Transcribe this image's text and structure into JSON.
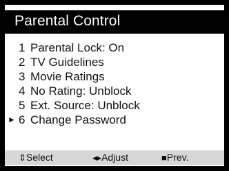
{
  "colors": {
    "title_bg": "#000000",
    "title_text": "#ffffff",
    "body_bg": "#ffffff",
    "footer_bg": "#d7d7d7",
    "text": "#111111"
  },
  "title": "Parental Control",
  "menu": {
    "items": [
      {
        "number": "1",
        "label": "Parental Lock:  On",
        "selected": false
      },
      {
        "number": "2",
        "label": "TV Guidelines",
        "selected": false
      },
      {
        "number": "3",
        "label": "Movie Ratings",
        "selected": false
      },
      {
        "number": "4",
        "label": "No Rating:  Unblock",
        "selected": false
      },
      {
        "number": "5",
        "label": "Ext. Source:  Unblock",
        "selected": false
      },
      {
        "number": "6",
        "label": "Change Password",
        "selected": true
      }
    ],
    "selection_marker": "►"
  },
  "footer": {
    "select": {
      "icon": "up-down-arrow-icon",
      "glyph": "⇕",
      "label": "Select"
    },
    "adjust": {
      "icon": "left-right-arrow-icon",
      "glyph": "◂▸",
      "label": "Adjust"
    },
    "prev": {
      "icon": "stop-square-icon",
      "glyph": "■",
      "label": "Prev."
    }
  }
}
